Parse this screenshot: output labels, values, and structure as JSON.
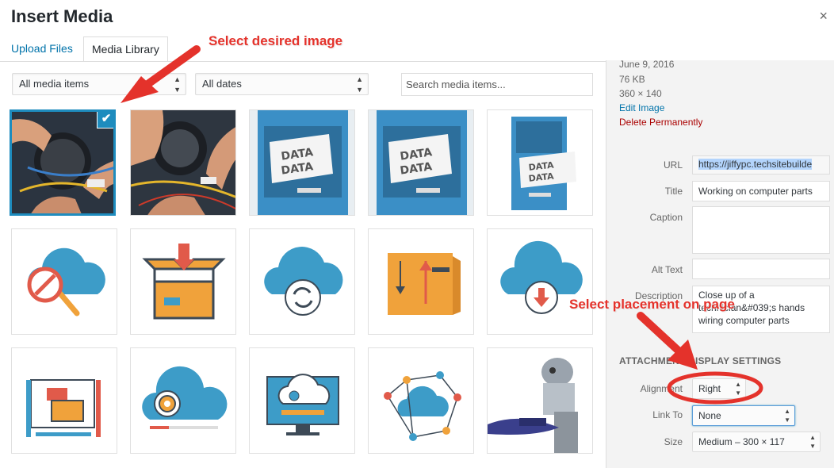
{
  "modal": {
    "title": "Insert Media",
    "close": "×"
  },
  "tabs": {
    "upload": "Upload Files",
    "library": "Media Library"
  },
  "filters": {
    "type": "All media items",
    "date": "All dates",
    "search_placeholder": "Search media items..."
  },
  "media_items": [
    {
      "kind": "photo-wiring",
      "selected": true
    },
    {
      "kind": "photo-wiring"
    },
    {
      "kind": "data-cabinet"
    },
    {
      "kind": "data-cabinet"
    },
    {
      "kind": "data-cabinet-tall"
    },
    {
      "kind": "cloud-search-icon"
    },
    {
      "kind": "box-download-icon"
    },
    {
      "kind": "cloud-sync-icon"
    },
    {
      "kind": "folder-upload-icon"
    },
    {
      "kind": "cloud-download-icon"
    },
    {
      "kind": "design-tools-icon"
    },
    {
      "kind": "cloud-settings-icon"
    },
    {
      "kind": "monitor-cloud-icon"
    },
    {
      "kind": "cloud-network-icon"
    },
    {
      "kind": "robot-photo"
    }
  ],
  "details": {
    "date": "June 9, 2016",
    "file_size": "76 KB",
    "dimensions": "360 × 140",
    "edit_link": "Edit Image",
    "delete_link": "Delete Permanently"
  },
  "fields": {
    "url_label": "URL",
    "url_value": "https://jiffypc.techsitebuilde",
    "title_label": "Title",
    "title_value": "Working on computer parts",
    "caption_label": "Caption",
    "caption_value": "",
    "alt_label": "Alt Text",
    "alt_value": "",
    "description_label": "Description",
    "description_value": "Close up of a technician&#039;s hands wiring computer parts"
  },
  "display_settings": {
    "title": "ATTACHMENT DISPLAY SETTINGS",
    "alignment_label": "Alignment",
    "alignment_value": "Right",
    "link_label": "Link To",
    "link_value": "None",
    "size_label": "Size",
    "size_value": "Medium – 300 × 117"
  },
  "annotations": {
    "select_image": "Select desired image",
    "select_placement": "Select placement on page"
  },
  "colors": {
    "accent": "#1e8cbe",
    "link": "#0073aa",
    "danger": "#a00",
    "annotation": "#e4322b",
    "icon_blue": "#3d9cc8",
    "icon_orange": "#f0a23b"
  }
}
